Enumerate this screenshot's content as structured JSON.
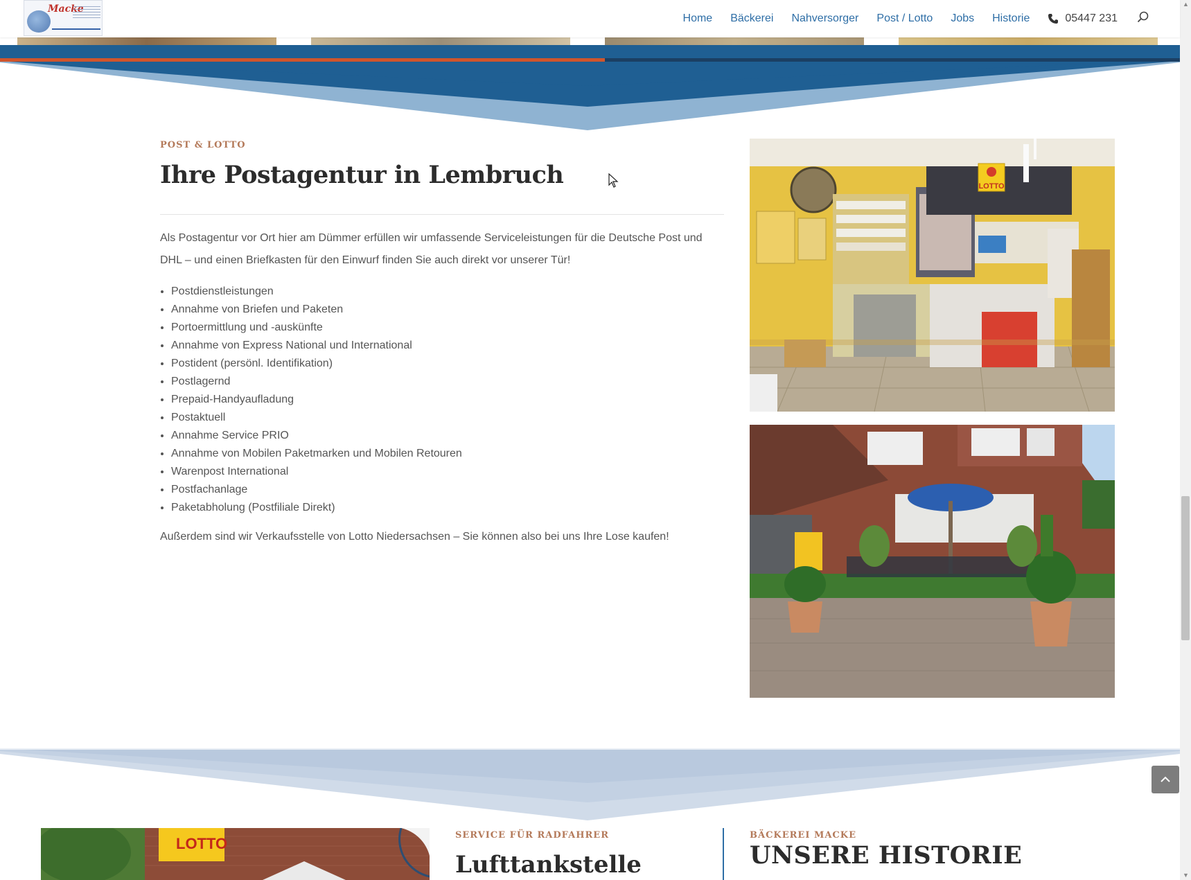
{
  "nav": {
    "items": [
      {
        "label": "Home"
      },
      {
        "label": "Bäckerei"
      },
      {
        "label": "Nahversorger"
      },
      {
        "label": "Post / Lotto"
      },
      {
        "label": "Jobs"
      },
      {
        "label": "Historie"
      }
    ],
    "phone": "05447 231",
    "link_color": "#2e6ea6"
  },
  "logo": {
    "wordmark": "Macke"
  },
  "slider": {
    "active_index": 2,
    "slide_count": 4
  },
  "section": {
    "eyebrow": "POST & LOTTO",
    "title": "Ihre Postagentur in Lembruch",
    "intro": "Als Postagentur vor Ort hier am Dümmer erfüllen wir umfassende Serviceleistungen für die Deutsche Post und DHL – und einen Briefkasten für den Einwurf finden Sie auch direkt vor unserer Tür!",
    "services": [
      "Postdienstleistungen",
      "Annahme von Briefen und Paketen",
      "Portoermittlung und -auskünfte",
      "Annahme von Express National und International",
      "Postident (persönl. Identifikation)",
      "Postlagernd",
      "Prepaid-Handyaufladung",
      "Postaktuell",
      "Annahme Service PRIO",
      "Annahme von Mobilen Paketmarken und Mobilen Retouren",
      "Warenpost International",
      "Postfachanlage",
      "Paketabholung (Postfiliale Direkt)"
    ],
    "outro": "Außerdem sind wir Verkaufsstelle von Lotto Niedersachsen – Sie können also bei uns Ihre Lose kaufen!"
  },
  "photos": {
    "interior_sign": "LOTTO",
    "interior_counter_sign": "LOTTO"
  },
  "bottom": {
    "photo_sign": "LOTTO",
    "air_station": {
      "eyebrow": "SERVICE FÜR RADFAHRER",
      "title": "Lufttankstelle"
    },
    "history": {
      "eyebrow": "BÄCKEREI MACKE",
      "title": "UNSERE HISTORIE"
    }
  },
  "colors": {
    "accent_orange": "#d0552c",
    "dark_blue": "#1b3f63",
    "brand_blue": "#2e6ea6",
    "eyebrow_brown": "#b47a5a"
  }
}
